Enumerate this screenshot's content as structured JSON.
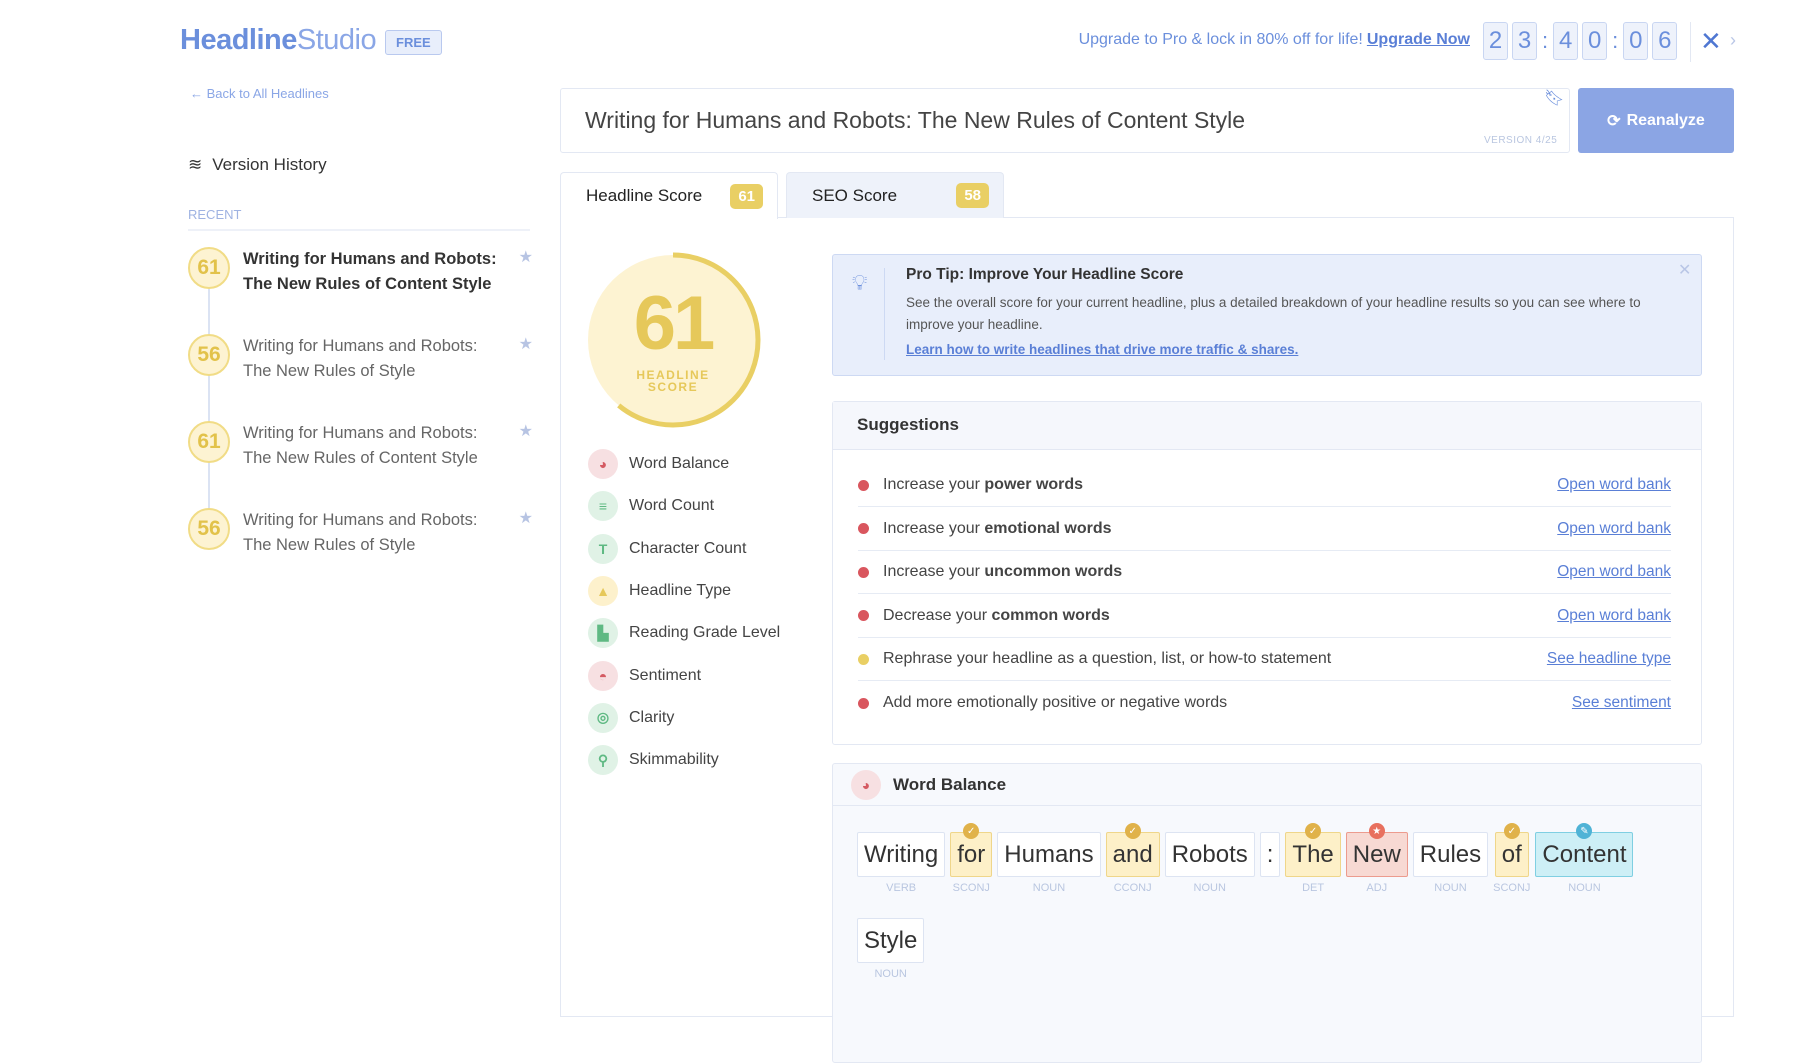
{
  "header": {
    "logo_bold": "Headline",
    "logo_light": "Studio",
    "plan_badge": "FREE",
    "upgrade_text": "Upgrade to Pro & lock in 80% off for life!",
    "upgrade_link": "Upgrade Now",
    "timer_digits": [
      "2",
      "3",
      "4",
      "0",
      "0",
      "6"
    ],
    "tools_icon": "tools-icon"
  },
  "sidebar": {
    "back_link": "← Back to All Headlines",
    "version_history": "Version History",
    "recent_label": "RECENT",
    "items": [
      {
        "score": "61",
        "title": "Writing for Humans and Robots: The New Rules of Content Style",
        "active": true
      },
      {
        "score": "56",
        "title": "Writing for Humans and Robots: The New Rules of Style"
      },
      {
        "score": "61",
        "title": "Writing for Humans and Robots: The New Rules of Content Style"
      },
      {
        "score": "56",
        "title": "Writing for Humans and Robots: The New Rules of Style"
      }
    ]
  },
  "editor": {
    "headline": "Writing for Humans and Robots: The New Rules of Content Style",
    "version": "VERSION 4/25",
    "reanalyze": "Reanalyze"
  },
  "tabs": [
    {
      "label": "Headline Score",
      "score": "61"
    },
    {
      "label": "SEO Score",
      "score": "58"
    }
  ],
  "score": {
    "value": "61",
    "label": "HEADLINE SCORE",
    "percent": 61,
    "color": "#e9cf64"
  },
  "metrics": [
    {
      "label": "Word Balance",
      "tone": "red",
      "icon": "pie-chart-icon"
    },
    {
      "label": "Word Count",
      "tone": "green",
      "icon": "lines-icon"
    },
    {
      "label": "Character Count",
      "tone": "green",
      "icon": "text-t-icon"
    },
    {
      "label": "Headline Type",
      "tone": "yellow",
      "icon": "shapes-icon"
    },
    {
      "label": "Reading Grade Level",
      "tone": "green",
      "icon": "book-icon"
    },
    {
      "label": "Sentiment",
      "tone": "red",
      "icon": "smile-icon"
    },
    {
      "label": "Clarity",
      "tone": "green",
      "icon": "target-icon"
    },
    {
      "label": "Skimmability",
      "tone": "green",
      "icon": "magnifier-icon"
    }
  ],
  "tip": {
    "title": "Pro Tip: Improve Your Headline Score",
    "body": "See the overall score for your current headline, plus a detailed breakdown of your headline results so you can see where to improve your headline.",
    "link": "Learn how to write headlines that drive more traffic & shares."
  },
  "suggestions": {
    "title": "Suggestions",
    "items": [
      {
        "pre": "Increase your ",
        "bold": "power words",
        "link": "Open word bank",
        "status": "red"
      },
      {
        "pre": "Increase your ",
        "bold": "emotional words",
        "link": "Open word bank",
        "status": "red"
      },
      {
        "pre": "Increase your ",
        "bold": "uncommon words",
        "link": "Open word bank",
        "status": "red"
      },
      {
        "pre": "Decrease your ",
        "bold": "common words",
        "link": "Open word bank",
        "status": "red"
      },
      {
        "pre": "Rephrase your headline as a question, list, or how-to statement",
        "bold": "",
        "link": "See headline type",
        "status": "yellow"
      },
      {
        "pre": "Add more emotionally positive or negative words",
        "bold": "",
        "link": "See sentiment",
        "status": "red"
      }
    ]
  },
  "word_balance": {
    "title": "Word Balance",
    "words": [
      {
        "w": "Writing",
        "pos": "VERB",
        "type": ""
      },
      {
        "w": "for",
        "pos": "SCONJ",
        "type": "common"
      },
      {
        "w": "Humans",
        "pos": "NOUN",
        "type": ""
      },
      {
        "w": "and",
        "pos": "CCONJ",
        "type": "common"
      },
      {
        "w": "Robots",
        "pos": "NOUN",
        "type": ""
      },
      {
        "w": ":",
        "pos": "",
        "type": ""
      },
      {
        "w": "The",
        "pos": "DET",
        "type": "common"
      },
      {
        "w": "New",
        "pos": "ADJ",
        "type": "power"
      },
      {
        "w": "Rules",
        "pos": "NOUN",
        "type": ""
      },
      {
        "w": "of",
        "pos": "SCONJ",
        "type": "common"
      },
      {
        "w": "Content",
        "pos": "NOUN",
        "type": "uncommon"
      },
      {
        "w": "Style",
        "pos": "NOUN",
        "type": ""
      }
    ]
  },
  "colors": {
    "brand": "#6b8fdc",
    "score_yellow": "#e9cf64",
    "red": "#d9565e",
    "button": "#8ba5e4"
  }
}
